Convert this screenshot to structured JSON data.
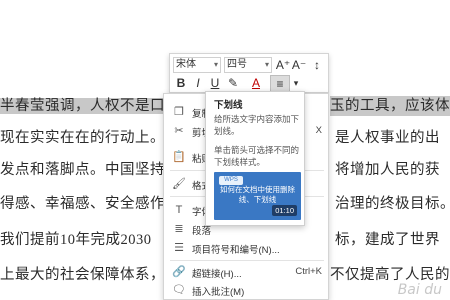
{
  "doc": {
    "lines": [
      {
        "left": "半春莹强调，人权不是口号",
        "right": "玉的工具，应该体"
      },
      {
        "left": "现在实实在在的行动上。人",
        "right": "是人权事业的出"
      },
      {
        "left": "发点和落脚点。中国坚持以",
        "right": "将增加人民的获"
      },
      {
        "left": "得感、幸福感、安全感作为",
        "right": "治理的终极目标。"
      },
      {
        "left": "我们提前10年完成2030",
        "right": "标，建成了世界"
      },
      {
        "left": "上最大的社会保障体系，",
        "right": "不仅提高了人民的"
      }
    ]
  },
  "toolbar": {
    "font_name": "宋体",
    "font_size": "四号",
    "grow_font": "A⁺",
    "shrink_font": "A⁻",
    "line_spacing": "↕",
    "bold": "B",
    "italic": "I",
    "underline": "U",
    "highlight": "✎",
    "font_color": "A",
    "align": "≡",
    "more": "▾"
  },
  "menu": {
    "items": [
      {
        "icon": "copy-icon",
        "label": "复制",
        "shortcut": ""
      },
      {
        "icon": "cut-icon",
        "label": "剪切",
        "shortcut": "X"
      },
      {
        "icon": "paste-icon",
        "label": "粘贴",
        "shortcut": ""
      },
      {
        "icon": "format-painter-icon",
        "label": "格式",
        "shortcut": ""
      },
      {
        "icon": "font-icon",
        "label": "字体",
        "shortcut": ""
      },
      {
        "icon": "paragraph-icon",
        "label": "段落",
        "shortcut": ""
      },
      {
        "icon": "list-icon",
        "label": "项目符号和编号(N)...",
        "shortcut": ""
      },
      {
        "icon": "link-icon",
        "label": "超链接(H)...",
        "shortcut": "Ctrl+K"
      },
      {
        "icon": "comment-icon",
        "label": "插入批注(M)",
        "shortcut": ""
      }
    ]
  },
  "tooltip": {
    "title": "下划线",
    "desc": "给所选文字内容添加下划线。",
    "desc2": "单击箭头可选择不同的下划线样式。",
    "video_logo": "WPS",
    "video_text": "如何在文档中使用删除线、下划线",
    "video_time": "01:10"
  },
  "watermark": "Bai du"
}
